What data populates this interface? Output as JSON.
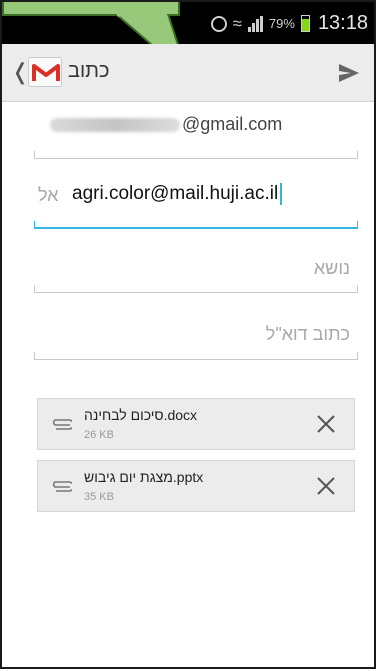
{
  "status_bar": {
    "battery_percent": "79%",
    "time": "13:18",
    "icons": [
      "alarm-icon",
      "wifi-icon",
      "signal-icon",
      "battery-icon"
    ]
  },
  "action_bar": {
    "title": "כתוב",
    "icons": [
      "back-chevron-icon",
      "gmail-logo-icon",
      "send-icon"
    ]
  },
  "compose": {
    "from_suffix": "@gmail.com",
    "to_label": "אל",
    "to_value": "agri.color@mail.huji.ac.il",
    "subject_placeholder": "נושא",
    "body_placeholder": "כתוב דוא\"ל"
  },
  "attachments": [
    {
      "name": "סיכום לבחינה.docx",
      "size": "26 KB"
    },
    {
      "name": "מצגת יום גיבוש.pptx",
      "size": "35 KB"
    }
  ],
  "colors": {
    "accent": "#33b5e5",
    "callout_fill": "#98c97a",
    "callout_border": "#3d6e28",
    "battery": "#8bd31d",
    "gmail_red": "#d93025"
  }
}
